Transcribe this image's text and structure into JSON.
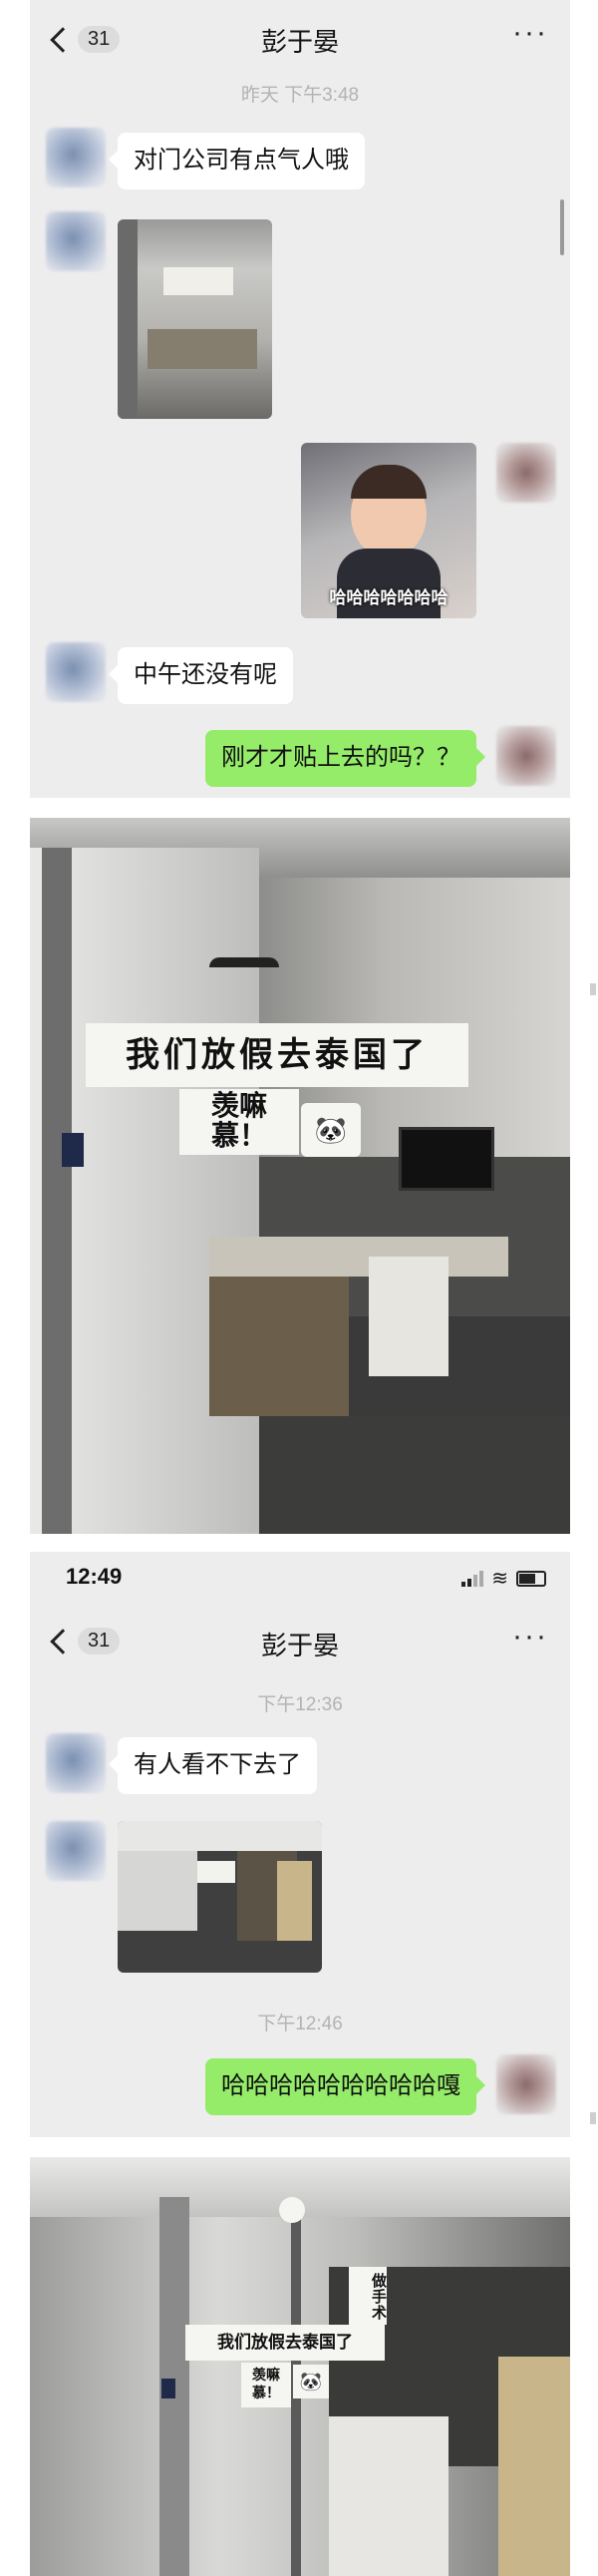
{
  "chat1": {
    "back_count": "31",
    "title": "彭于晏",
    "more": "···",
    "timestamp": "昨天 下午3:48",
    "messages": [
      {
        "text": "对门公司有点气人哦"
      },
      {
        "image_caption": "哈哈哈哈哈哈哈"
      },
      {
        "text": "中午还没有呢"
      },
      {
        "text": "刚才才贴上去的吗？？"
      }
    ]
  },
  "photo1": {
    "sign_line1": "我们放假去泰国了",
    "sign_line2": "羡嘛",
    "sign_line3": "慕！"
  },
  "chat2": {
    "status_time": "12:49",
    "back_count": "31",
    "title": "彭于晏",
    "more": "···",
    "timestamp1": "下午12:36",
    "msg1": "有人看不下去了",
    "timestamp2": "下午12:46",
    "msg2": "哈哈哈哈哈哈哈哈哈嘎"
  },
  "photo2": {
    "sign_main": "我们放假去泰国了",
    "sign_small1": "羡嘛",
    "sign_small2": "慕！",
    "sign_side": "做手术"
  }
}
